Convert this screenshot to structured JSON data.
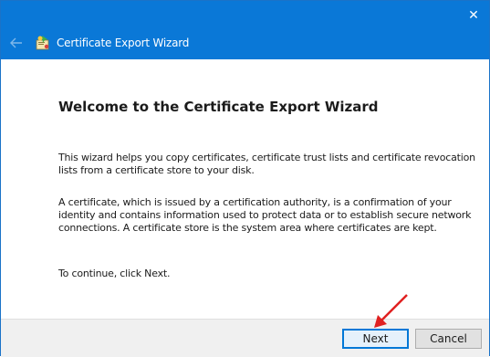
{
  "window": {
    "title": "Certificate Export Wizard",
    "close_glyph": "✕",
    "accent_color": "#0a78d7"
  },
  "icons": {
    "back": "arrow-left-icon",
    "wizard": "certificate-icon",
    "close": "close-icon"
  },
  "content": {
    "heading": "Welcome to the Certificate Export Wizard",
    "paragraph1": "This wizard helps you copy certificates, certificate trust lists and certificate revocation lists from a certificate store to your disk.",
    "paragraph2": "A certificate, which is issued by a certification authority, is a confirmation of your identity and contains information used to protect data or to establish secure network connections. A certificate store is the system area where certificates are kept.",
    "paragraph3": "To continue, click Next."
  },
  "footer": {
    "next_label": "Next",
    "cancel_label": "Cancel"
  },
  "annotation": {
    "arrow_color": "#e02020"
  }
}
